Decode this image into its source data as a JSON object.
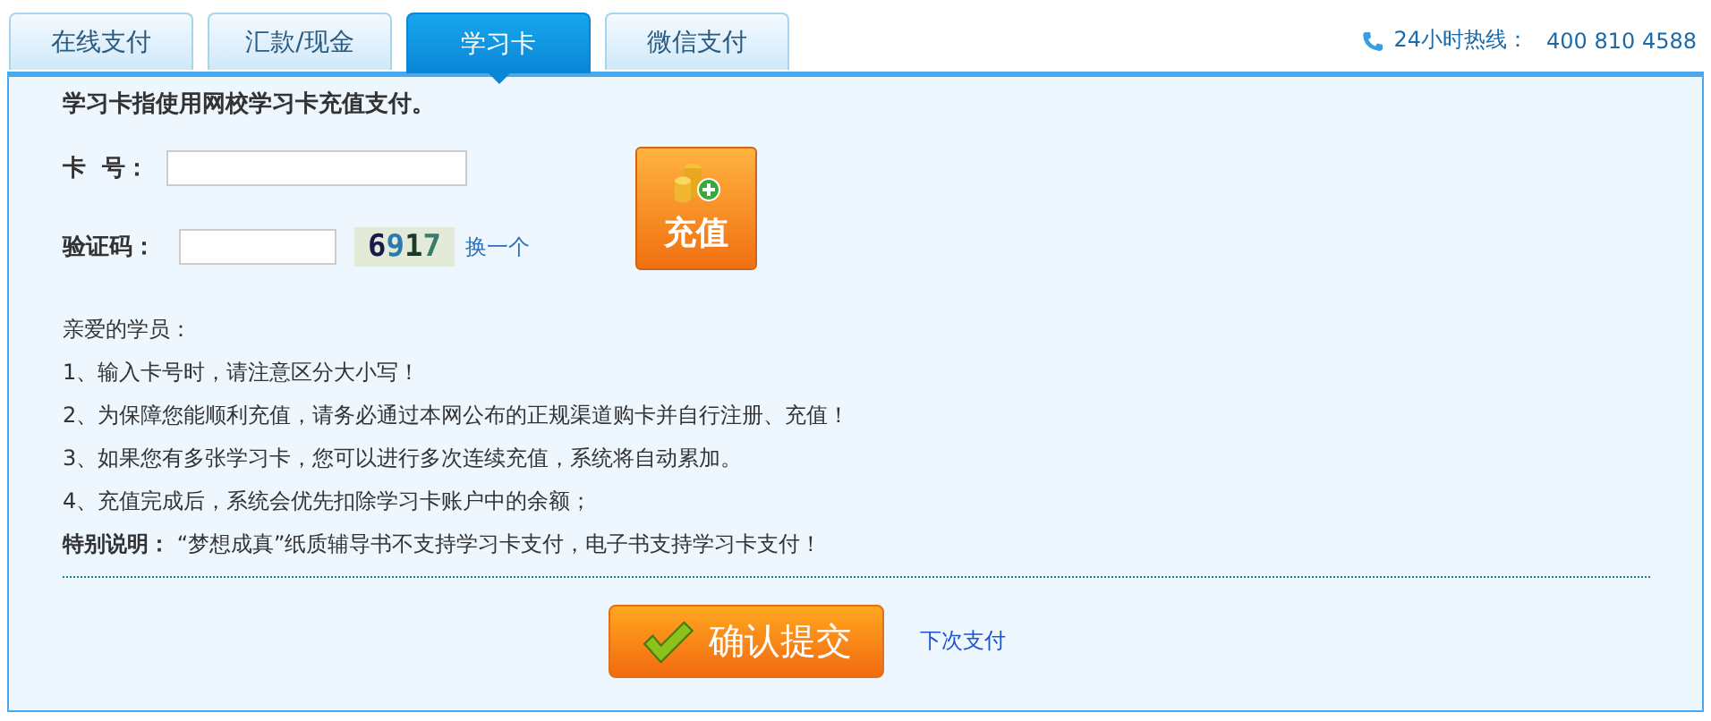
{
  "tabs": [
    {
      "label": "在线支付",
      "selected": false
    },
    {
      "label": "汇款/现金",
      "selected": false
    },
    {
      "label": "学习卡",
      "selected": true
    },
    {
      "label": "微信支付",
      "selected": false
    }
  ],
  "hotline": {
    "label": "24小时热线：",
    "number": "400 810 4588"
  },
  "intro": "学习卡指使用网校学习卡充值支付。",
  "card_field": {
    "label": "卡  号："
  },
  "captcha_field": {
    "label": "验证码：",
    "captcha": "6917",
    "refresh_link": "换一个"
  },
  "recharge_button": "充值",
  "notes": [
    "亲爱的学员：",
    "1、输入卡号时，请注意区分大小写！",
    "2、为保障您能顺利充值，请务必通过本网公布的正规渠道购卡并自行注册、充值！",
    "3、如果您有多张学习卡，您可以进行多次连续充值，系统将自动累加。",
    "4、充值完成后，系统会优先扣除学习卡账户中的余额；",
    "**特别说明：** “梦想成真”纸质辅导书不支持学习卡支付，电子书支持学习卡支付！"
  ],
  "submit_button": "确认提交",
  "later_link": "下次支付"
}
